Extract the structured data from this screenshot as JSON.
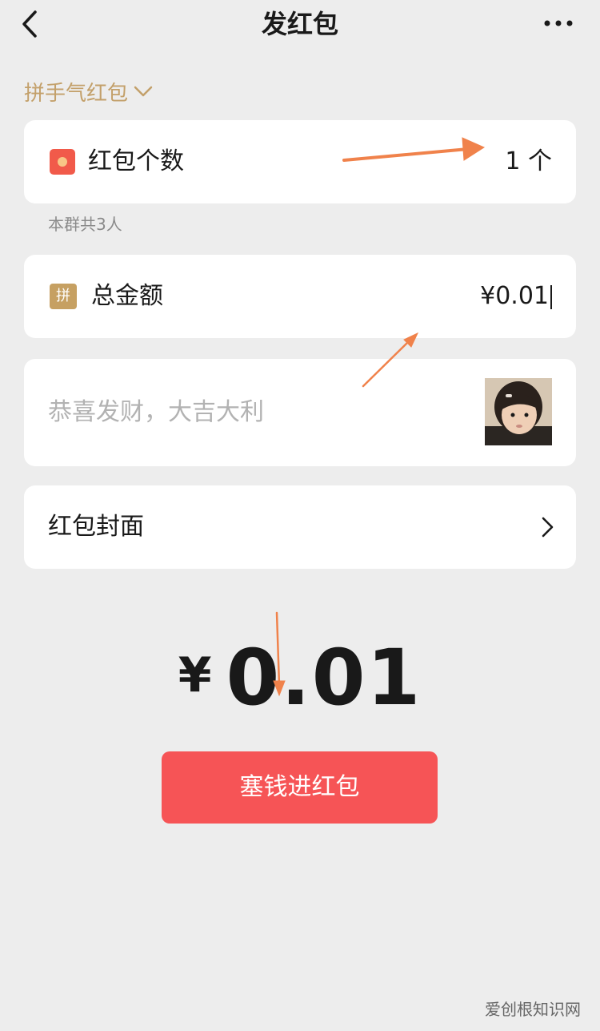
{
  "header": {
    "title": "发红包"
  },
  "packet_type": {
    "label": "拼手气红包"
  },
  "count_row": {
    "label": "红包个数",
    "value": "1 个"
  },
  "group_hint": "本群共3人",
  "amount_row": {
    "badge": "拼",
    "label": "总金额",
    "value": "¥0.01"
  },
  "greeting": {
    "placeholder": "恭喜发财，大吉大利"
  },
  "cover_row": {
    "label": "红包封面"
  },
  "total": {
    "currency": "¥",
    "amount": "0.01"
  },
  "send_button": {
    "label": "塞钱进红包"
  },
  "watermark": "爱创根知识网",
  "colors": {
    "accent_red": "#f65456",
    "gold": "#c3a06a",
    "arrow": "#f0824b"
  }
}
